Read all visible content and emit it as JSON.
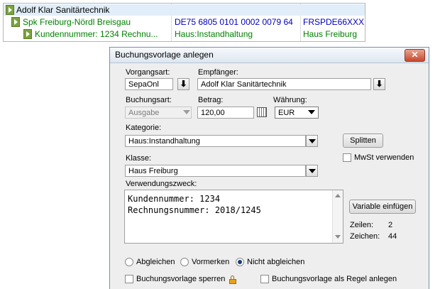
{
  "tree": {
    "rows": [
      {
        "name": "Adolf Klar Sanitärtechnik",
        "col2": "",
        "col3": ""
      },
      {
        "name": "Spk Freiburg-Nördl Breisgau",
        "col2": "DE75 6805 0101 0002 0079 64",
        "col3": "FRSPDE66XXX"
      },
      {
        "name": "Kundennummer: 1234 Rechnu...",
        "col2": "Haus:Instandhaltung",
        "col3": "Haus Freiburg"
      }
    ]
  },
  "dialog": {
    "title": "Buchungsvorlage anlegen",
    "close": "✕",
    "vorgangsart": {
      "label": "Vorgangsart:",
      "value": "SepaOnl"
    },
    "empfaenger": {
      "label": "Empfänger:",
      "value": "Adolf Klar Sanitärtechnik"
    },
    "buchungsart": {
      "label": "Buchungsart:",
      "value": "Ausgabe"
    },
    "betrag": {
      "label": "Betrag:",
      "value": "120,00"
    },
    "waehrung": {
      "label": "Währung:",
      "value": "EUR"
    },
    "kategorie": {
      "label": "Kategorie:",
      "value": "Haus:Instandhaltung"
    },
    "splitten": "Splitten",
    "mwst": "MwSt verwenden",
    "klasse": {
      "label": "Klasse:",
      "value": "Haus Freiburg"
    },
    "verwendungszweck": {
      "label": "Verwendungszweck:",
      "value": "Kundennummer: 1234\nRechnungsnummer: 2018/1245"
    },
    "variable": "Variable einfügen",
    "zeilen": {
      "label": "Zeilen:",
      "value": "2"
    },
    "zeichen": {
      "label": "Zeichen:",
      "value": "44"
    },
    "radios": {
      "abgleichen": "Abgleichen",
      "vormerken": "Vormerken",
      "nicht": "Nicht abgleichen"
    },
    "sperren": "Buchungsvorlage sperren",
    "regel": "Buchungsvorlage als Regel anlegen"
  }
}
